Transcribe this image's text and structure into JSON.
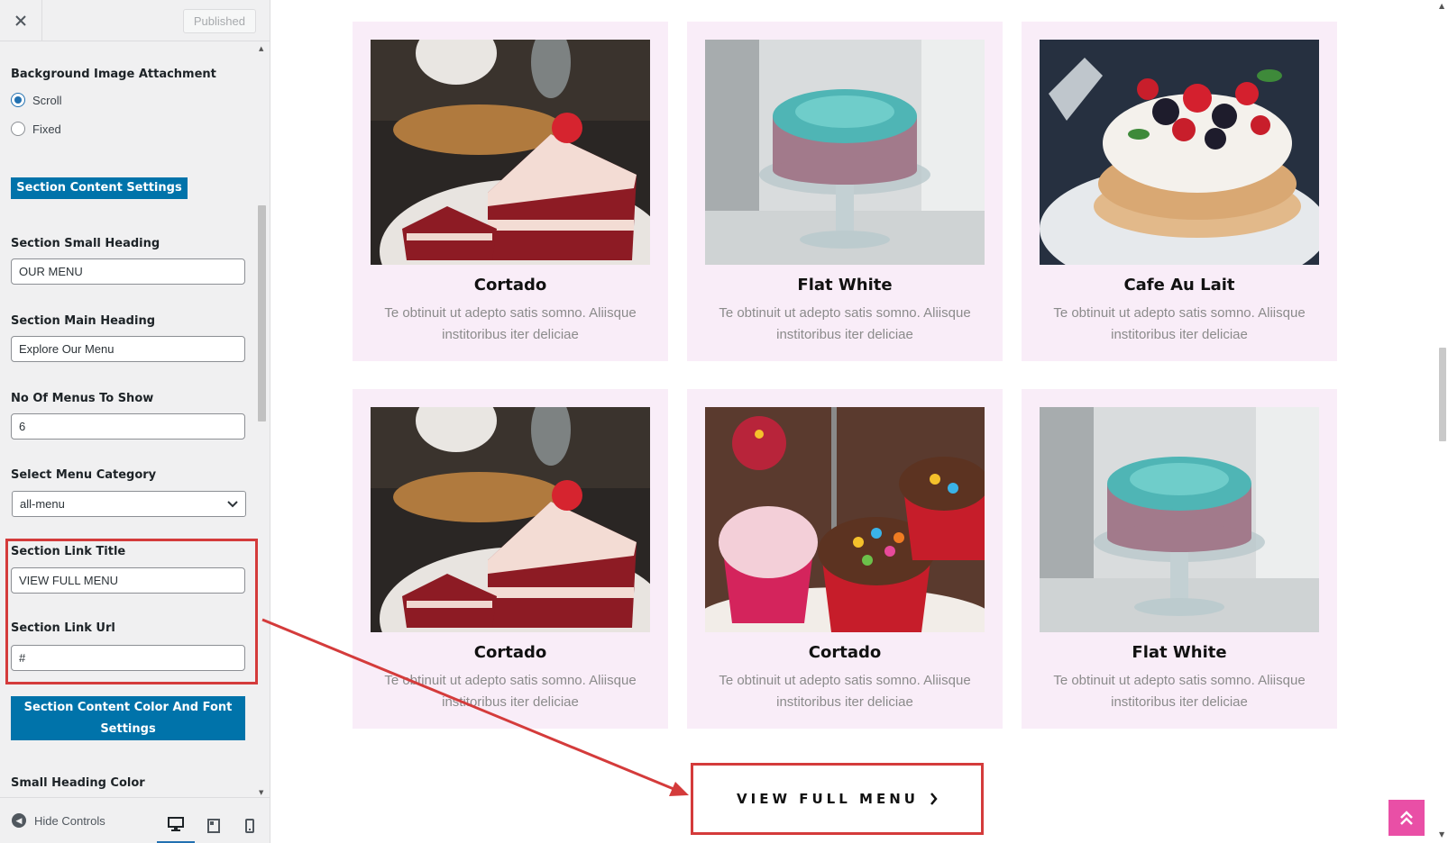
{
  "header": {
    "close_icon": "close-icon",
    "publish_label": "Published"
  },
  "attachment": {
    "label": "Background Image Attachment",
    "options": [
      "Scroll",
      "Fixed"
    ],
    "selected": "Scroll"
  },
  "content_settings_label": "Section Content Settings",
  "fields": {
    "small_heading": {
      "label": "Section Small Heading",
      "value": "OUR MENU"
    },
    "main_heading": {
      "label": "Section Main Heading",
      "value": "Explore Our Menu"
    },
    "menus_count": {
      "label": "No Of Menus To Show",
      "value": "6"
    },
    "category": {
      "label": "Select Menu Category",
      "value": "all-menu"
    },
    "link_title": {
      "label": "Section Link Title",
      "value": "VIEW FULL MENU"
    },
    "link_url": {
      "label": "Section Link Url",
      "value": "#"
    }
  },
  "color_font_label": "Section Content Color And Font Settings",
  "small_heading_color_label": "Small Heading Color",
  "footer": {
    "hide_controls_label": "Hide Controls",
    "devices": [
      "desktop",
      "tablet",
      "mobile"
    ],
    "active_device": "desktop"
  },
  "menu_cards": [
    {
      "title": "Cortado",
      "desc": "Te obtinuit ut adepto satis somno. Aliisque institoribus iter deliciae",
      "image": "red-velvet-cake"
    },
    {
      "title": "Flat White",
      "desc": "Te obtinuit ut adepto satis somno. Aliisque institoribus iter deliciae",
      "image": "teal-frosted-cake"
    },
    {
      "title": "Cafe Au Lait",
      "desc": "Te obtinuit ut adepto satis somno. Aliisque institoribus iter deliciae",
      "image": "berry-pavlova"
    },
    {
      "title": "Cortado",
      "desc": "Te obtinuit ut adepto satis somno. Aliisque institoribus iter deliciae",
      "image": "red-velvet-cake"
    },
    {
      "title": "Cortado",
      "desc": "Te obtinuit ut adepto satis somno. Aliisque institoribus iter deliciae",
      "image": "sprinkle-cupcakes"
    },
    {
      "title": "Flat White",
      "desc": "Te obtinuit ut adepto satis somno. Aliisque institoribus iter deliciae",
      "image": "teal-frosted-cake"
    }
  ],
  "view_full_menu": {
    "label": "VIEW FULL MENU",
    "icon": "chevron-right-icon"
  },
  "colors": {
    "accent_blue": "#0073aa",
    "highlight_red": "#d43b3b",
    "card_bg": "#f9edf8",
    "scroll_top_pink": "#e94fa6"
  }
}
